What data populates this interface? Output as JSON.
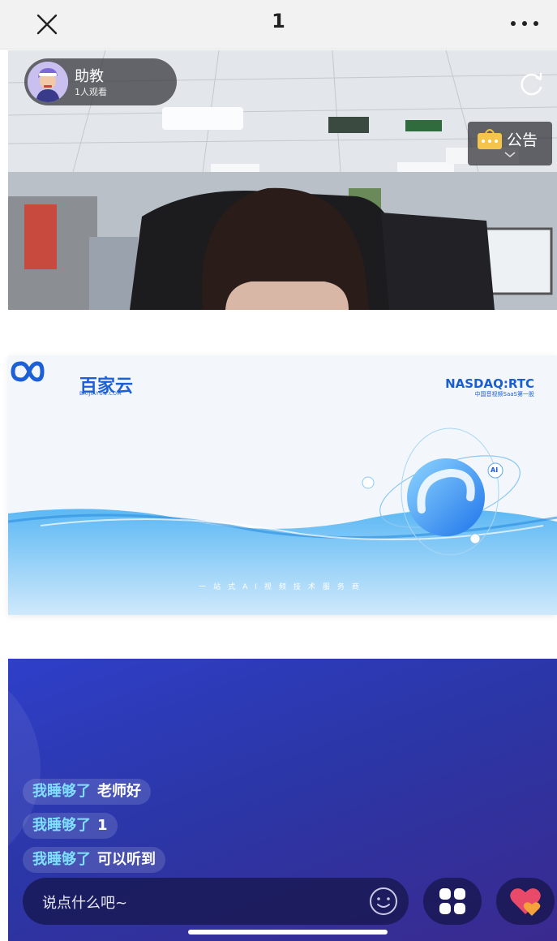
{
  "topbar": {
    "title": "1",
    "close_icon": "close-icon",
    "more_icon": "more-horizontal-icon"
  },
  "live": {
    "host_name": "助教",
    "viewer_count": "1人观看",
    "notice_label": "公告",
    "refresh_icon": "refresh-icon"
  },
  "slide": {
    "brand_name": "百家云",
    "brand_domain": "BAIJIAYUN.COM",
    "ticker": "NASDAQ:RTC",
    "ticker_sub": "中国音视频SaaS第一股",
    "tagline": "一站式AI视频技术服务商",
    "badge_ai": "AI"
  },
  "chat": {
    "messages": [
      {
        "user": "我睡够了",
        "text": "老师好"
      },
      {
        "user": "我睡够了",
        "text": "1"
      },
      {
        "user": "我睡够了",
        "text": "可以听到"
      }
    ],
    "input_placeholder": "说点什么吧~"
  },
  "colors": {
    "brand_blue": "#1d5fd6",
    "chat_bg": "#2f3fc9",
    "username": "#7fe0ff"
  }
}
